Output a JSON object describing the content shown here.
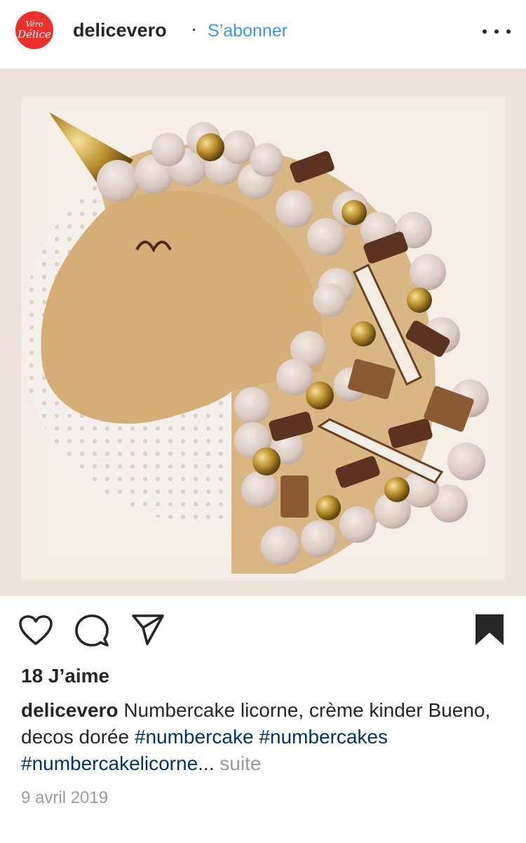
{
  "header": {
    "avatar_text_top": "Véro",
    "avatar_text_bottom": "Délice",
    "username": "delicevero",
    "separator": "·",
    "follow_label": "S’abonner"
  },
  "post": {
    "image_description": "Unicorn number cake",
    "likes": "18 J’aime",
    "caption_user": "delicevero",
    "caption_text": "Numbercake licorne, crème kinder Bueno, decos dorée",
    "hashtags": [
      "#numbercake",
      "#numbercakes",
      "#numbercakelicorne"
    ],
    "ellipsis": "...",
    "more_label": "suite",
    "date": "9 avril 2019"
  },
  "icons": {
    "more": "more-options-icon",
    "like": "heart-icon",
    "comment": "comment-icon",
    "share": "share-icon",
    "save": "bookmark-icon"
  },
  "colors": {
    "text": "#262626",
    "follow": "#3897f0",
    "hashtag": "#003569",
    "muted": "#999999",
    "avatar_bg": "#e8312c"
  }
}
